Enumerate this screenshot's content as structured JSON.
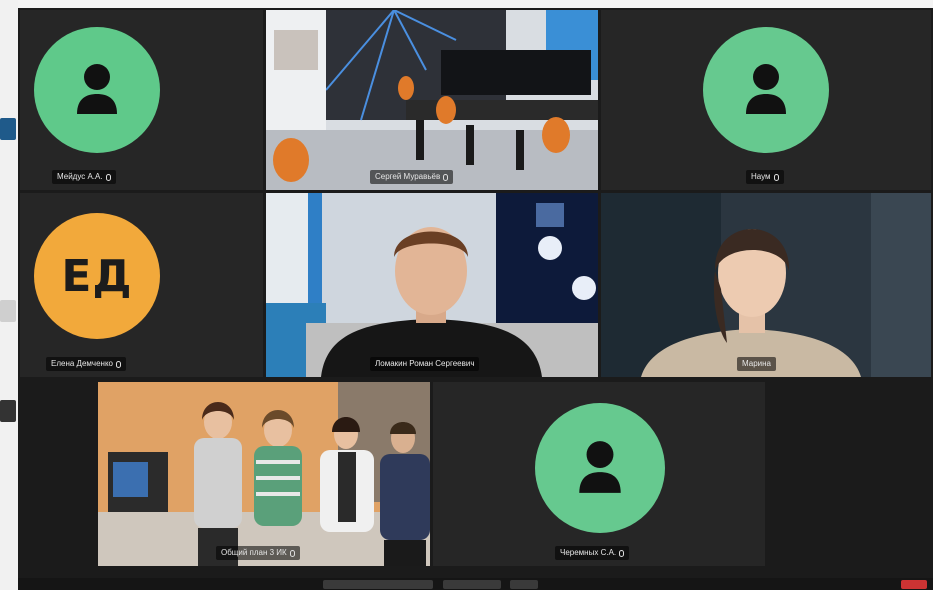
{
  "colors": {
    "app_bg": "#1b1b1b",
    "tile_bg": "#262626",
    "avatar_green": "#5fc98a",
    "avatar_green_2": "#66c98f",
    "avatar_orange": "#f2a93b",
    "active_speaker_border": "#d9c35a"
  },
  "participants": [
    {
      "name": "Мейдус А.А.",
      "type": "avatar",
      "icon": "person-icon",
      "muted": true
    },
    {
      "name": "Сергей Муравьёв",
      "type": "video",
      "scene": "computer-lab",
      "muted": true
    },
    {
      "name": "Наум",
      "type": "avatar",
      "icon": "person-icon",
      "muted": true
    },
    {
      "name": "Елена Демченко",
      "type": "avatar",
      "initials": "ЕД",
      "muted": true
    },
    {
      "name": "Ломакин Роман Сергеевич",
      "type": "video",
      "scene": "man-in-office",
      "muted": false
    },
    {
      "name": "Марина",
      "type": "video",
      "scene": "woman-webcam",
      "muted": false,
      "active": true
    },
    {
      "name": "Общий план 3 ИК",
      "type": "video",
      "scene": "group-photo",
      "muted": true
    },
    {
      "name": "Черемных С.А.",
      "type": "avatar",
      "icon": "person-icon",
      "muted": true
    }
  ]
}
